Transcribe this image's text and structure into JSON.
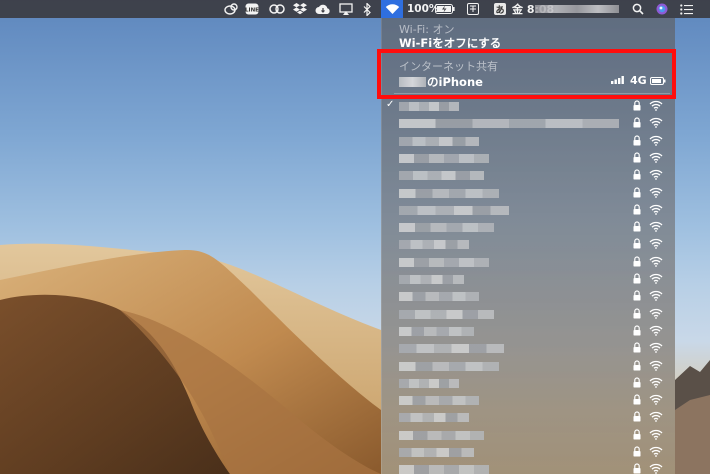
{
  "menubar": {
    "battery_percent": "100%",
    "input_method": "あ",
    "clock": "金 8:08",
    "icons": [
      "creative-cloud-icon",
      "line-icon",
      "adobe-cc-icon",
      "dropbox-icon",
      "cloud-icon",
      "airplay-icon",
      "bluetooth-icon",
      "wifi-icon",
      "battery-charging-icon",
      "search-icon",
      "siri-icon",
      "notification-center-icon"
    ]
  },
  "wifi_menu": {
    "status": "Wi-Fi: オン",
    "toggle_action": "Wi-Fiをオフにする",
    "hotspot_section": "インターネット共有",
    "hotspot": {
      "device_name": "のiPhone",
      "network_type": "4G"
    },
    "networks_count_visible": 22
  },
  "colors": {
    "highlight": "#ff0d0d",
    "selected_menubar_item": "#2f6fe0"
  }
}
